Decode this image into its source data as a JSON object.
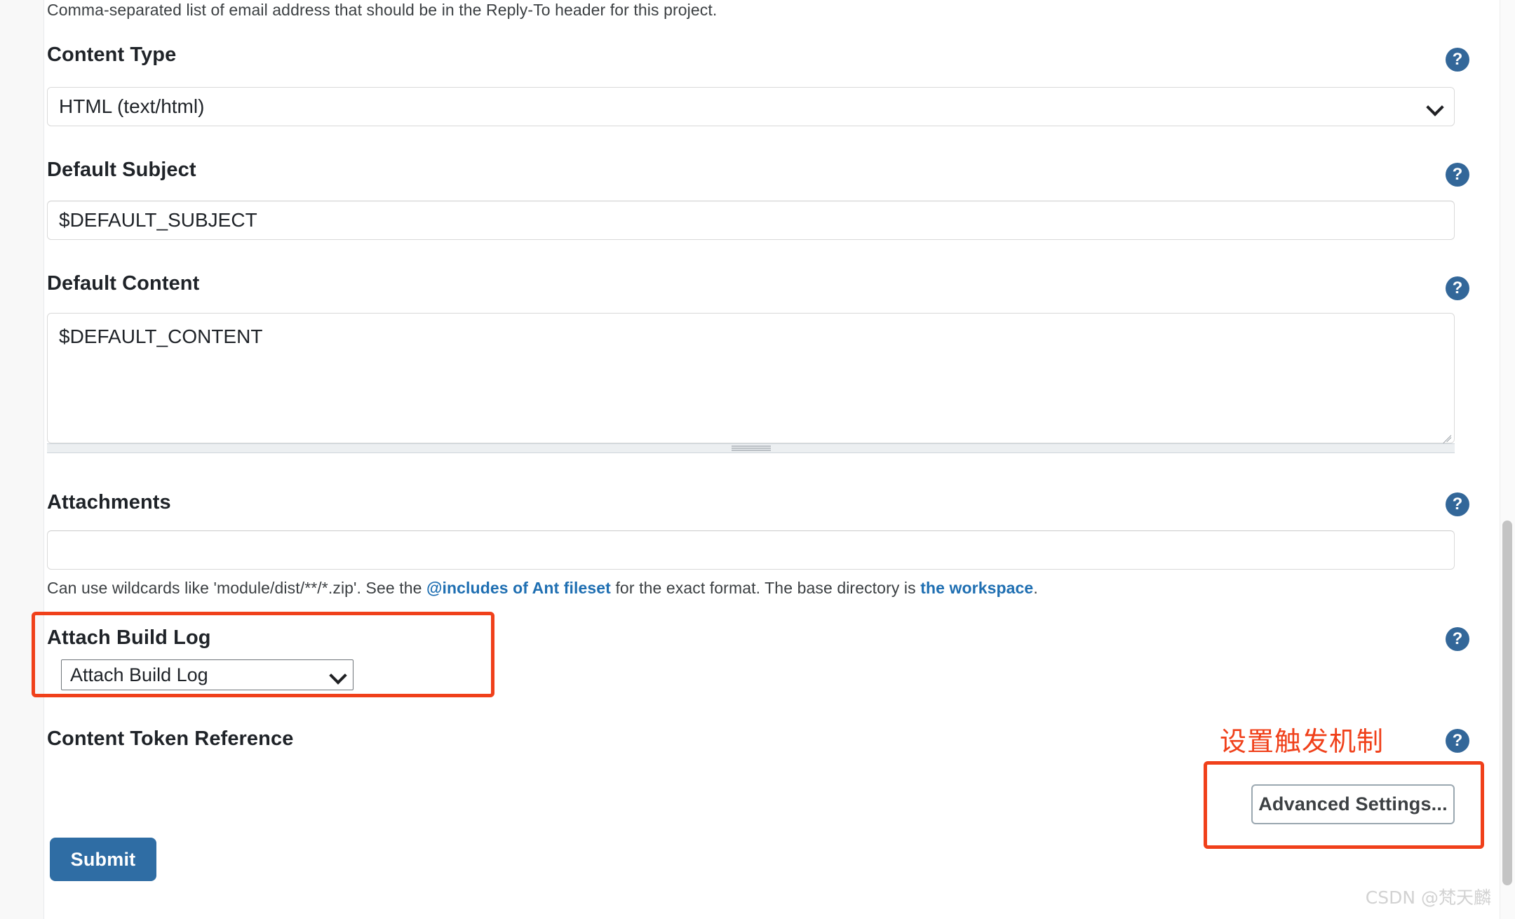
{
  "colors": {
    "accent_blue": "#336799",
    "link_blue": "#1f6fb2",
    "annotation_red": "#f0401a",
    "submit_blue": "#2f6da4",
    "watermark_gray": "#d2d2d2"
  },
  "top_help_text": "Comma-separated list of email address that should be in the Reply-To header for this project.",
  "help_icon_glyph": "?",
  "fields": {
    "content_type": {
      "label": "Content Type",
      "value": "HTML (text/html)",
      "help_icon": "help-icon"
    },
    "default_subject": {
      "label": "Default Subject",
      "value": "$DEFAULT_SUBJECT",
      "placeholder": "",
      "help_icon": "help-icon"
    },
    "default_content": {
      "label": "Default Content",
      "value": "$DEFAULT_CONTENT",
      "placeholder": "",
      "help_icon": "help-icon"
    },
    "attachments": {
      "label": "Attachments",
      "value": "",
      "placeholder": "",
      "help_icon": "help-icon",
      "hint_part1": "Can use wildcards like 'module/dist/**/*.zip'. See the ",
      "hint_link1": "@includes of Ant fileset",
      "hint_part2": " for the exact format. The base directory is ",
      "hint_link2": "the workspace",
      "hint_part3": "."
    },
    "attach_build_log": {
      "label": "Attach Build Log",
      "value": "Attach Build Log",
      "help_icon": "help-icon"
    },
    "content_token_reference": {
      "label": "Content Token Reference",
      "help_icon": "help-icon"
    }
  },
  "annotations": {
    "chinese_note": "设置触发机制"
  },
  "buttons": {
    "advanced_settings": "Advanced Settings...",
    "submit": "Submit"
  },
  "watermark": "CSDN @梵天麟"
}
